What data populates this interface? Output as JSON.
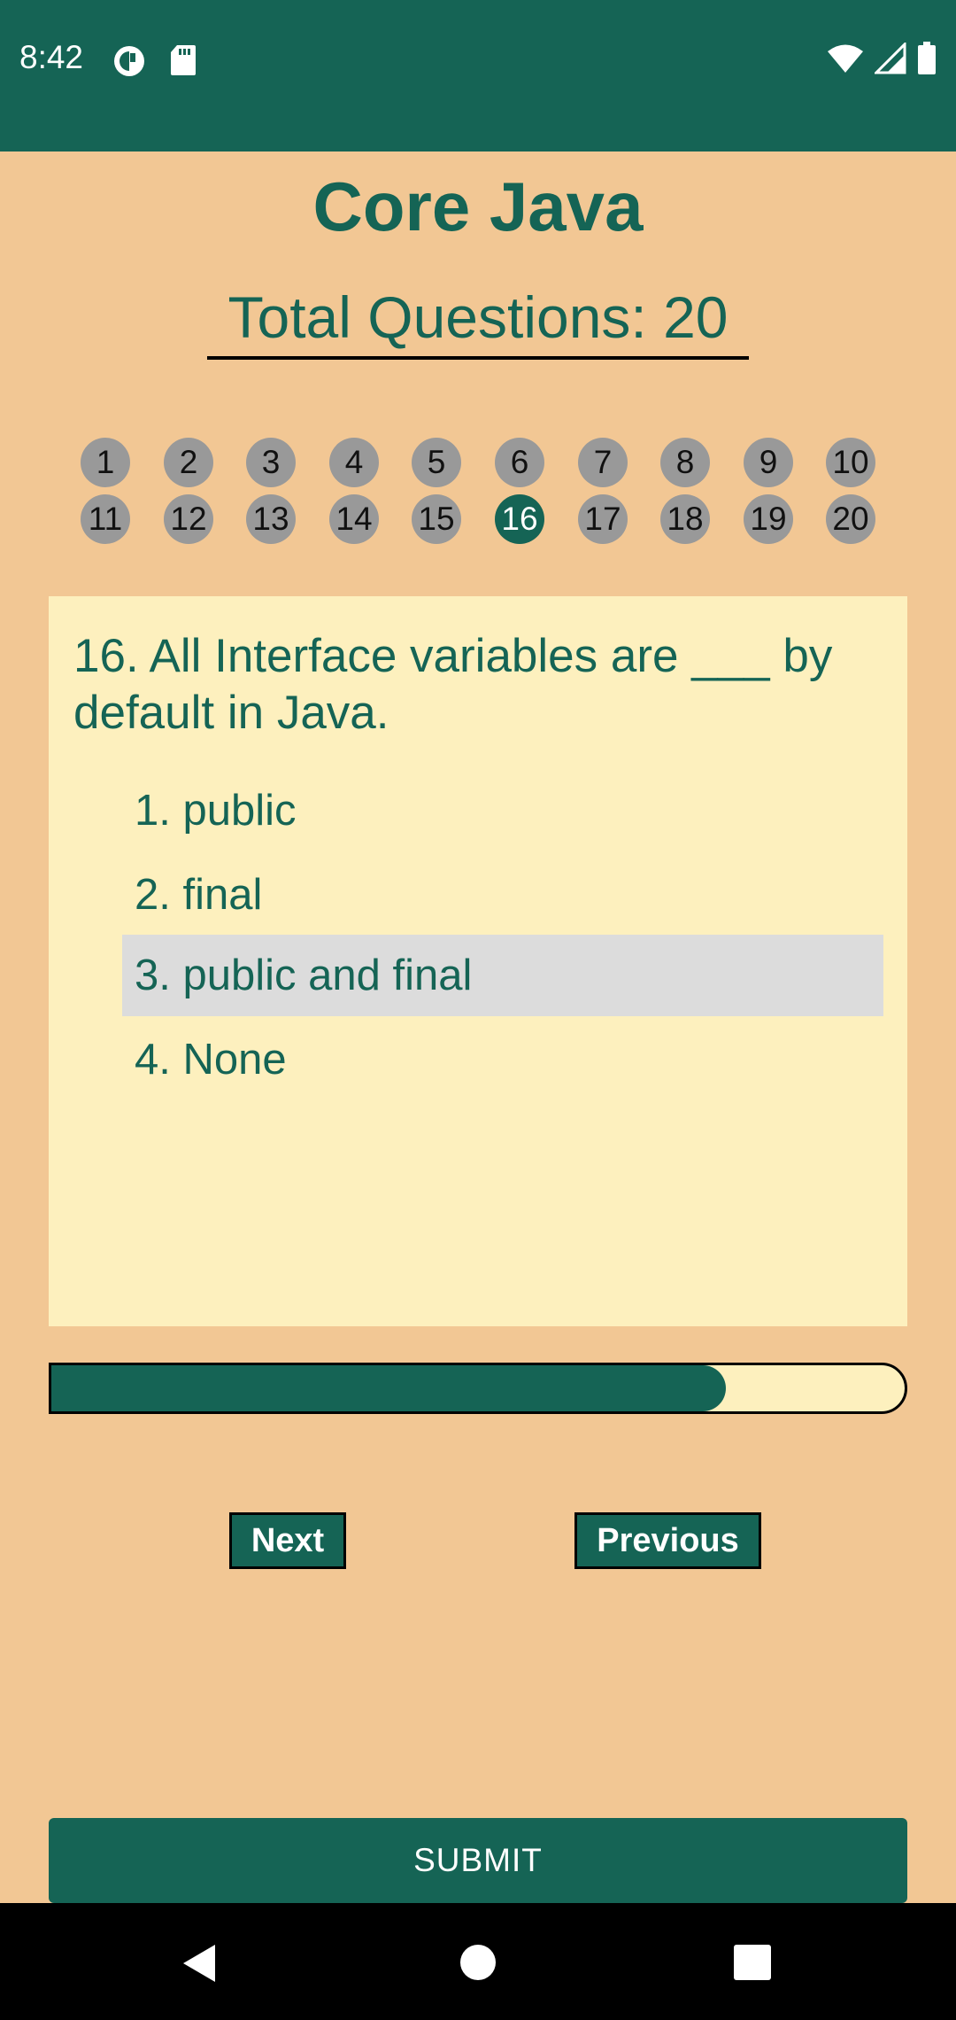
{
  "status": {
    "time": "8:42"
  },
  "header": {
    "title": "Core Java",
    "total_questions": "Total Questions: 20"
  },
  "question_nav": [
    "1",
    "2",
    "3",
    "4",
    "5",
    "6",
    "7",
    "8",
    "9",
    "10",
    "11",
    "12",
    "13",
    "14",
    "15",
    "16",
    "17",
    "18",
    "19",
    "20"
  ],
  "current_question": 16,
  "question": {
    "text": "16. All Interface variables are ___ by default in Java.",
    "options": [
      "1. public",
      "2. final",
      "3. public and final",
      "4. None"
    ],
    "selected_option": 3
  },
  "progress": {
    "fraction": 0.79
  },
  "buttons": {
    "next": "Next",
    "previous": "Previous",
    "submit": "SUBMIT"
  },
  "colors": {
    "primary": "#156455",
    "background": "#F2C794",
    "card": "#FDF0BE",
    "selected": "#DCDCDC",
    "inactive_number": "#999999"
  },
  "icons": {
    "status_left": [
      "data-saver-icon",
      "sd-card-icon"
    ],
    "status_right": [
      "wifi-icon",
      "signal-icon",
      "battery-icon"
    ],
    "navbar": [
      "back-icon",
      "home-icon",
      "recents-icon"
    ]
  }
}
